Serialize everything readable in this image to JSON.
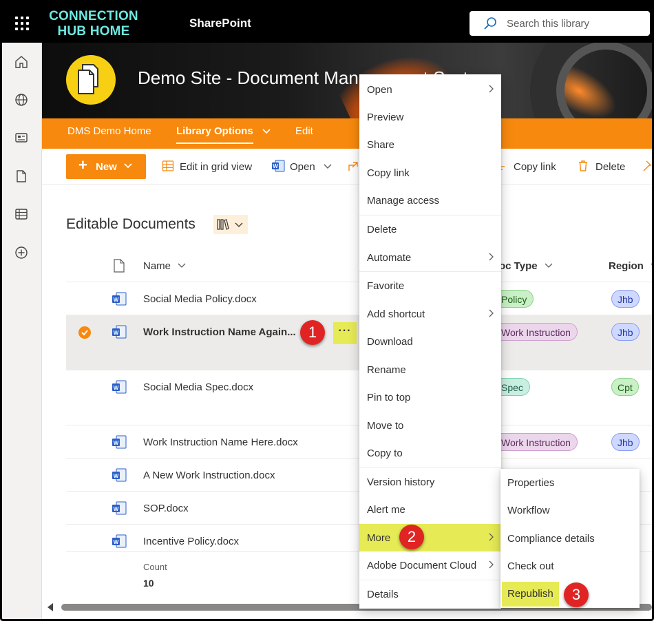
{
  "topbar": {
    "brand_line1": "CONNECTION",
    "brand_line2": "HUB HOME",
    "app_name": "SharePoint",
    "search_placeholder": "Search this library"
  },
  "rail": {
    "icons": [
      "home-icon",
      "globe-icon",
      "news-icon",
      "page-icon",
      "list-icon",
      "add-icon"
    ]
  },
  "site": {
    "title": "Demo Site - Document Management Systems"
  },
  "nav": {
    "items": [
      {
        "label": "DMS Demo Home"
      },
      {
        "label": "Library Options",
        "active": true,
        "has_dropdown": true
      },
      {
        "label": "Edit"
      }
    ]
  },
  "command_bar": {
    "new_label": "New",
    "edit_grid_label": "Edit in grid view",
    "open_label": "Open",
    "copy_link_label": "Copy link",
    "delete_label": "Delete"
  },
  "library": {
    "title": "Editable Documents",
    "columns": {
      "name": "Name",
      "doc_type": "oc Type",
      "region": "Region"
    },
    "rows": [
      {
        "name": "Social Media Policy.docx",
        "doc_type": "Policy",
        "region": "Jhb"
      },
      {
        "name": "Work Instruction Name Again...",
        "doc_type": "Work Instruction",
        "region": "Jhb",
        "selected": true,
        "more": "···"
      },
      {
        "name": "Social Media Spec.docx",
        "doc_type": "Spec",
        "region": "Cpt"
      },
      {
        "name": "Work Instruction Name Here.docx",
        "doc_type": "Work Instruction",
        "region": "Jhb"
      },
      {
        "name": "A New Work Instruction.docx"
      },
      {
        "name": "SOP.docx"
      },
      {
        "name": "Incentive Policy.docx"
      }
    ],
    "count_label": "Count",
    "count_value": "10"
  },
  "context_menu": {
    "items": [
      {
        "label": "Open",
        "submenu": true
      },
      {
        "label": "Preview"
      },
      {
        "label": "Share"
      },
      {
        "label": "Copy link"
      },
      {
        "label": "Manage access"
      },
      {
        "label": "Delete"
      },
      {
        "label": "Automate",
        "submenu": true
      },
      {
        "label": "Favorite"
      },
      {
        "label": "Add shortcut",
        "submenu": true
      },
      {
        "label": "Download"
      },
      {
        "label": "Rename"
      },
      {
        "label": "Pin to top"
      },
      {
        "label": "Move to"
      },
      {
        "label": "Copy to"
      },
      {
        "label": "Version history"
      },
      {
        "label": "Alert me"
      },
      {
        "label": "More",
        "submenu": true,
        "highlighted": true
      },
      {
        "label": "Adobe Document Cloud",
        "submenu": true
      },
      {
        "label": "Details"
      }
    ]
  },
  "more_submenu": {
    "items": [
      {
        "label": "Properties"
      },
      {
        "label": "Workflow"
      },
      {
        "label": "Compliance details"
      },
      {
        "label": "Check out"
      },
      {
        "label": "Republish",
        "highlighted": true
      }
    ]
  },
  "step_badges": [
    "1",
    "2",
    "3"
  ],
  "colors": {
    "accent_orange": "#f7890e",
    "highlight_yellow": "#e6ea55",
    "brand_cyan": "#6ee8e0",
    "step_badge_red": "#e02424"
  }
}
